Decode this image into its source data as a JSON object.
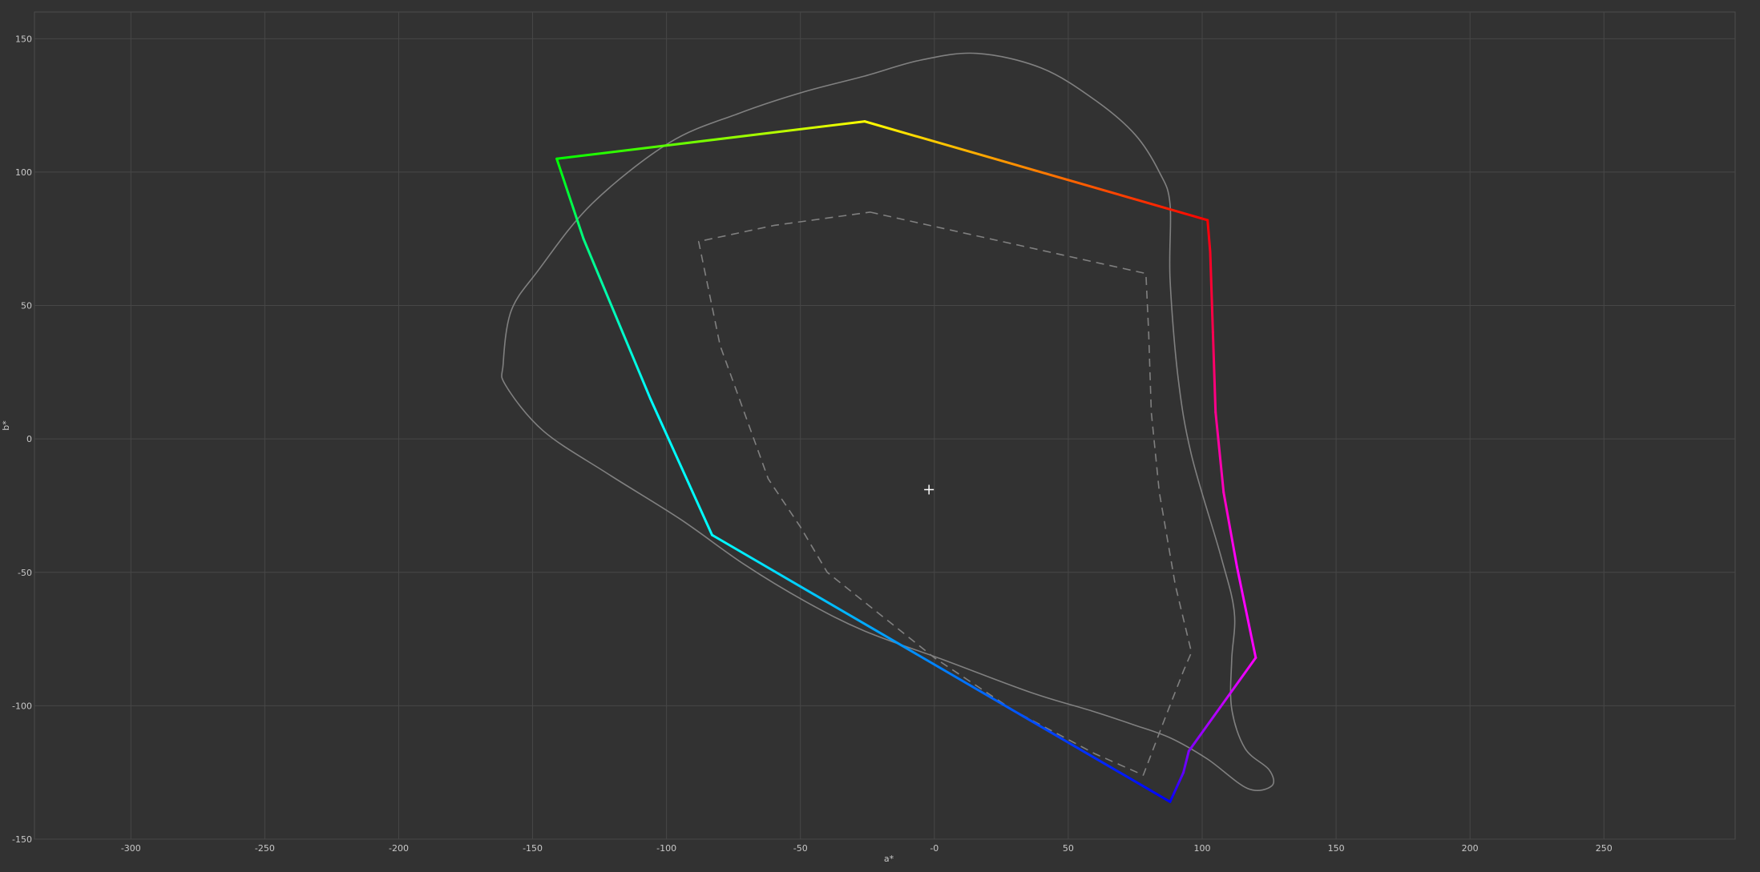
{
  "chart_data": {
    "type": "line",
    "xlabel": "a*",
    "ylabel": "b*",
    "xlim": [
      -336,
      299
    ],
    "ylim": [
      -150,
      160
    ],
    "x_ticks": [
      -300,
      -250,
      -200,
      -150,
      -100,
      -50,
      0,
      50,
      100,
      150,
      200,
      250
    ],
    "x_tick_labels": [
      "-300",
      "-250",
      "-200",
      "-150",
      "-100",
      "-50",
      "-0",
      "50",
      "100",
      "150",
      "200",
      "250"
    ],
    "y_ticks": [
      150,
      100,
      50,
      0,
      -50,
      -100,
      -150
    ],
    "y_tick_labels": [
      "150",
      "100",
      "50",
      "0",
      "-50",
      "-100",
      "-150"
    ],
    "grid": true,
    "colors": {
      "background": "#323232",
      "grid": "#474747",
      "frame": "#4c4c4c",
      "reference": "#808080"
    },
    "crosshair": {
      "a": -2,
      "b": -19
    },
    "series": [
      {
        "style": "solid-reference",
        "closed": true,
        "x": [
          16,
          -5,
          -26,
          -49,
          -73,
          -99,
          -128,
          -148,
          -158,
          -161,
          -160,
          -146,
          -122,
          -95,
          -71,
          -48,
          -26,
          4,
          36,
          59,
          74,
          88,
          102,
          117,
          126,
          125,
          116,
          111,
          111,
          112,
          107,
          96,
          91,
          88,
          88,
          84,
          75,
          60,
          40
        ],
        "y": [
          144.5,
          142,
          136,
          130,
          122,
          111,
          88,
          63,
          48,
          28,
          20,
          3,
          -13,
          -30,
          -47,
          -61,
          -72,
          -83,
          -95,
          -102,
          -107,
          -112,
          -120,
          -131,
          -130,
          -124,
          -116,
          -101,
          -83,
          -65,
          -44,
          -6,
          23,
          60,
          88,
          100,
          114,
          127,
          139
        ]
      },
      {
        "style": "dashed-reference",
        "closed": true,
        "x": [
          -24,
          79,
          80,
          81,
          84,
          90,
          96,
          93,
          86,
          78,
          60,
          30,
          0,
          -40,
          -50,
          -62,
          -80,
          -88,
          -60
        ],
        "y": [
          85,
          62,
          40,
          10,
          -20,
          -55,
          -80,
          -87,
          -105,
          -126,
          -118,
          -102,
          -82,
          -50,
          -33,
          -15,
          35,
          74,
          80
        ]
      },
      {
        "style": "gamut",
        "closed": true,
        "x": [
          102,
          -26,
          -141,
          -131,
          -106,
          -83,
          88,
          93,
          95,
          120,
          113,
          108,
          105,
          104,
          103
        ],
        "y": [
          82,
          119,
          105,
          75,
          15,
          -36,
          -136,
          -125,
          -117,
          -82,
          -48,
          -20,
          10,
          40,
          70
        ],
        "colors": [
          "#ff0000",
          "#ffff00",
          "#00ff00",
          "#00ff80",
          "#00ffff",
          "#00ffff",
          "#0000ff",
          "#6000ff",
          "#8000ff",
          "#ff00ff",
          "#ff00ff",
          "#ff00c0",
          "#ff0090",
          "#ff0050",
          "#ff0020"
        ]
      }
    ]
  }
}
